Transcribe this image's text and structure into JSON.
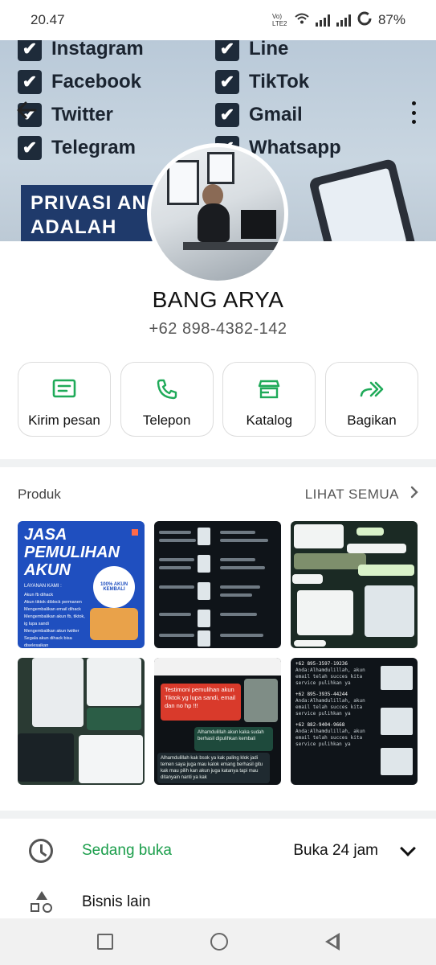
{
  "status_bar": {
    "time": "20.47",
    "network": "Vo) LTE2",
    "battery": "87%"
  },
  "cover": {
    "checklist_left": [
      "Instagram",
      "Facebook",
      "Twitter",
      "Telegram"
    ],
    "checklist_right": [
      "Line",
      "TikTok",
      "Gmail",
      "Whatsapp"
    ],
    "banner_text": "PRIVASI AN ADALAH PRIORITAS"
  },
  "profile": {
    "name": "BANG ARYA",
    "phone": "+62 898-4382-142"
  },
  "actions": [
    {
      "label": "Kirim pesan",
      "icon": "message-icon"
    },
    {
      "label": "Telepon",
      "icon": "phone-icon"
    },
    {
      "label": "Katalog",
      "icon": "store-icon"
    },
    {
      "label": "Bagikan",
      "icon": "share-icon"
    }
  ],
  "products": {
    "title": "Produk",
    "see_all": "LIHAT SEMUA",
    "tile1": {
      "headline": "JASA PEMULIHAN AKUN",
      "tag": "JASA",
      "subtitle": "LAYANAN KAMI :",
      "items": [
        "Akun fb dihack",
        "Akun tiktok diblock permanen",
        "Mengembalikan email dihack",
        "Mengembalikan akun fb, tiktok, ig lupa sandi",
        "Mengembalikan akun twitter",
        "Segala akun dihack bisa diselesaikan"
      ],
      "badge": "100% AKUN KEMBALI"
    },
    "tile5": {
      "red_text": "Testimoni pemulihan akun Tiktok yg lupa sandi, email dan no hp !!!",
      "green_text": "Alhamdulillah akun kaka sudah berhasil dipulihkan kembali",
      "grey_text": "Alhamdulillah kak bsok ya kak paling klok jadi temen saya juga mau kalok emang berhasil gitu kak mau pilih kan akun juga katanya tapi mau ditanyain nanti ya kak"
    },
    "tile6": {
      "lines": [
        "+62 895-3597-19236",
        "Anda:Alhamdulillah, akun email telah succes kita service pulihkan ya",
        "+62 895-3935-44244",
        "Anda:Alhamdulillah, akun email telah succes kita service pulihkan ya",
        "+62 882-9404-9668",
        "Anda:Alhamdulillah, akun email telah succes kita service pulihkan ya"
      ]
    }
  },
  "hours": {
    "status": "Sedang buka",
    "hours": "Buka 24 jam"
  },
  "other": {
    "label": "Bisnis lain"
  },
  "colors": {
    "accent_green": "#1b9e4b",
    "action_icon_green": "#1faa59",
    "divider": "#f0f2f3",
    "nav_bg": "#f1f1f1"
  }
}
